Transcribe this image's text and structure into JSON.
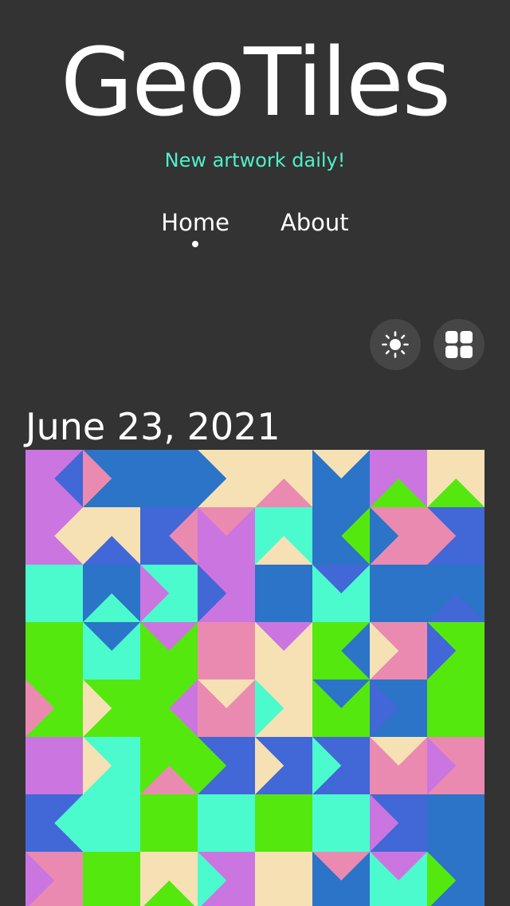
{
  "site": {
    "title": "GeoTiles",
    "tagline": "New artwork daily!"
  },
  "nav": {
    "items": [
      {
        "label": "Home",
        "active": true
      },
      {
        "label": "About",
        "active": false
      }
    ]
  },
  "toolbar": {
    "theme_icon": "sun-icon",
    "grid_icon": "grid-icon"
  },
  "post": {
    "date": "June 23, 2021"
  },
  "artwork": {
    "palette": {
      "P": "#cb75e0",
      "B": "#2b74c8",
      "I": "#4267d6",
      "Y": "#f5e1b4",
      "R": "#ea8ab0",
      "C": "#4bfbcd",
      "G": "#54e80f"
    },
    "cols": 8,
    "rows": 8,
    "cells": [
      [
        "PI.E",
        "BR.W",
        "BB.E",
        "YB.W",
        "YR.S",
        "BY.N",
        "PG.S",
        "YG.S"
      ],
      [
        "PY.E",
        "YI.S",
        "IR.E",
        "PR.N",
        "CY.S",
        "BG.E",
        "RB.W",
        "IR.W"
      ],
      [
        "CC.E",
        "BC.S",
        "CP.W",
        "PI.W",
        "BB.E",
        "CI.N",
        "BB.E",
        "BI.S"
      ],
      [
        "GG.E",
        "CB.N",
        "GP.N",
        "RR.E",
        "YP.N",
        "GB.E",
        "RY.W",
        "GI.W"
      ],
      [
        "GR.W",
        "GY.W",
        "GP.E",
        "RY.N",
        "YC.W",
        "GB.N",
        "BI.W",
        "GG.E"
      ],
      [
        "PP.E",
        "CY.W",
        "GR.S",
        "IG.W",
        "IY.W",
        "IC.W",
        "RY.N",
        "RP.W"
      ],
      [
        "IC.E",
        "CC.E",
        "GG.S",
        "CC.S",
        "GG.E",
        "CC.E",
        "IP.W",
        "BB.E"
      ],
      [
        "RP.W",
        "GG.E",
        "YG.S",
        "PC.W",
        "YY.E",
        "BR.N",
        "CP.N",
        "BG.W"
      ]
    ]
  }
}
